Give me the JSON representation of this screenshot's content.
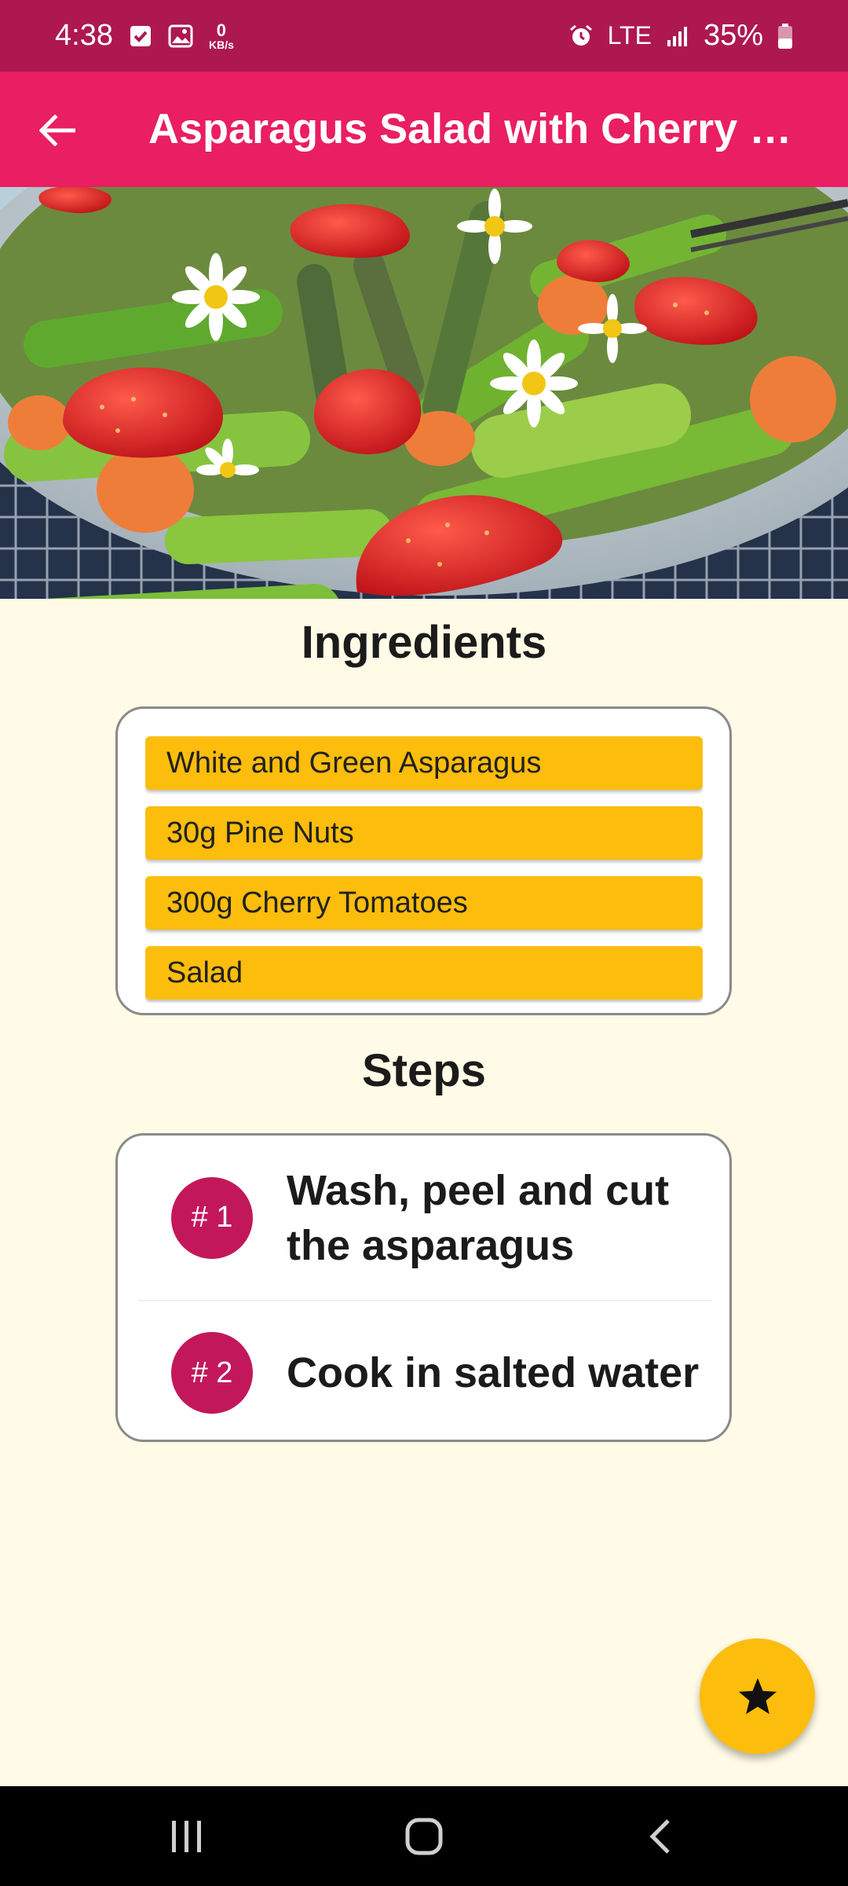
{
  "status_bar": {
    "time": "4:38",
    "data_rate_value": "0",
    "data_rate_unit": "KB/s",
    "network": "LTE",
    "battery": "35%",
    "icons": [
      "checkbox-icon",
      "image-icon",
      "alarm-icon",
      "signal-icon",
      "battery-icon"
    ]
  },
  "app_bar": {
    "title": "Asparagus Salad with Cherry Tomatoes",
    "color": "#e91e63"
  },
  "ingredients": {
    "heading": "Ingredients",
    "items": [
      "White and Green Asparagus",
      "30g Pine Nuts",
      "300g Cherry Tomatoes",
      "Salad"
    ]
  },
  "steps": {
    "heading": "Steps",
    "items": [
      {
        "badge": "# 1",
        "text": "Wash, peel and cut the asparagus"
      },
      {
        "badge": "# 2",
        "text": "Cook in salted water"
      }
    ]
  },
  "fab": {
    "icon": "star-icon",
    "color": "#fdbd0c"
  },
  "nav_bar": {
    "icons": [
      "recents-icon",
      "home-icon",
      "back-nav-icon"
    ]
  },
  "colors": {
    "accent": "#c2185b",
    "background": "#fffbe6",
    "ingredient_chip": "#fdbd0c"
  }
}
